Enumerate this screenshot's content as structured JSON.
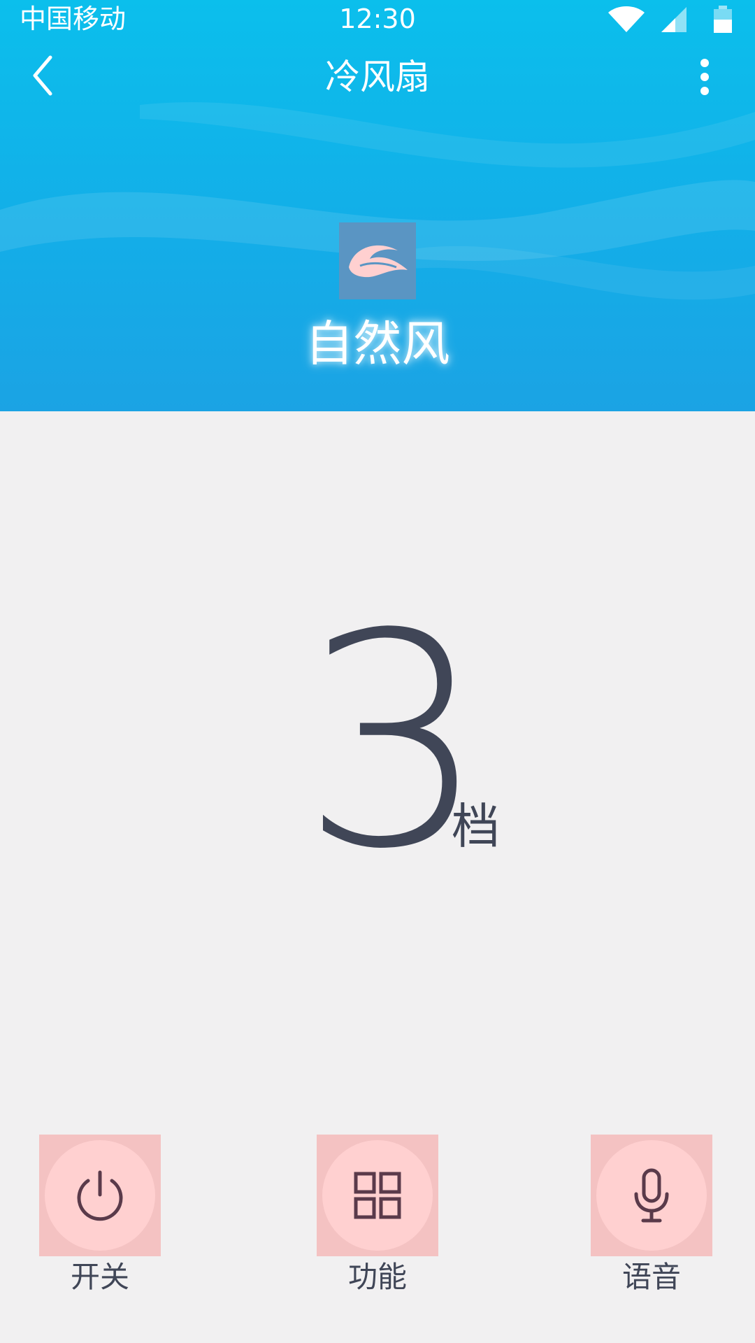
{
  "status_bar": {
    "carrier": "中国移动",
    "time": "12:30",
    "icons": [
      "wifi-icon",
      "signal-icon",
      "battery-icon"
    ]
  },
  "header": {
    "title": "冷风扇",
    "back_icon": "chevron-left-icon",
    "more_icon": "more-vertical-icon"
  },
  "mode": {
    "icon": "leaf-wind-icon",
    "label": "自然风"
  },
  "speed": {
    "value": "3",
    "unit": "档"
  },
  "controls": [
    {
      "label": "开关",
      "icon": "power-icon"
    },
    {
      "label": "功能",
      "icon": "grid-icon"
    },
    {
      "label": "语音",
      "icon": "microphone-icon"
    }
  ],
  "colors": {
    "header_blue": "#13aee8",
    "text_dark": "#404657",
    "background": "#f1f0f1",
    "button_bg": "#f4c2c2",
    "button_circle": "#ffd0d0"
  }
}
